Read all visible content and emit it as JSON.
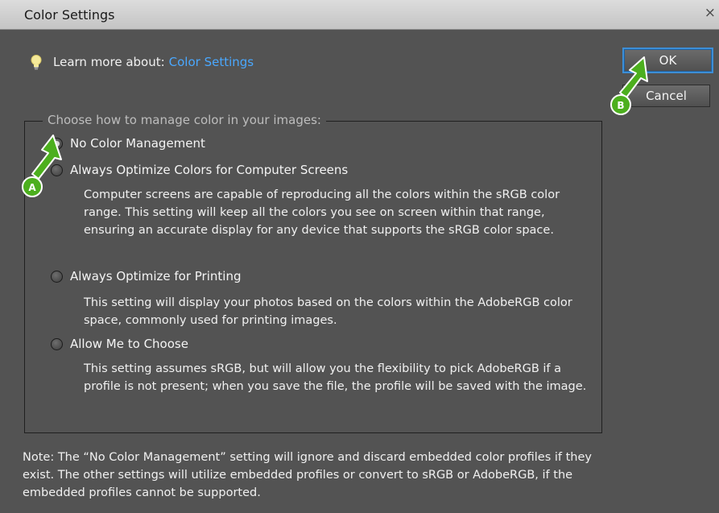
{
  "window": {
    "title": "Color Settings",
    "close_glyph": "×"
  },
  "learn": {
    "prefix": "Learn more about:",
    "link": "Color Settings",
    "icon": "lightbulb-icon"
  },
  "buttons": {
    "ok": "OK",
    "cancel": "Cancel"
  },
  "group": {
    "legend": "Choose how to manage color in your images:",
    "options": [
      {
        "label": "No Color Management",
        "checked": true,
        "description": ""
      },
      {
        "label": "Always Optimize Colors for Computer Screens",
        "checked": false,
        "description": "Computer screens are capable of reproducing all the colors within the sRGB color range. This setting will keep all the colors you see on screen within that range, ensuring an accurate display for any device that supports the sRGB color space."
      },
      {
        "label": "Always Optimize for Printing",
        "checked": false,
        "description": "This setting will display your photos based on the colors within the AdobeRGB color space, commonly used for printing images."
      },
      {
        "label": "Allow Me to Choose",
        "checked": false,
        "description": "This setting assumes sRGB, but will allow you the flexibility to pick AdobeRGB if a profile is not present; when you save the file, the profile will be saved with the image."
      }
    ]
  },
  "note": "Note: The “No Color Management” setting will ignore and discard embedded color profiles if they exist. The other settings will utilize embedded profiles or convert to sRGB or AdobeRGB, if the embedded profiles cannot be supported.",
  "callouts": {
    "a": "A",
    "b": "B"
  },
  "colors": {
    "background": "#535353",
    "link": "#4aa8ff",
    "callout_green": "#4caf1e",
    "focus_border": "#3d8ed6"
  }
}
